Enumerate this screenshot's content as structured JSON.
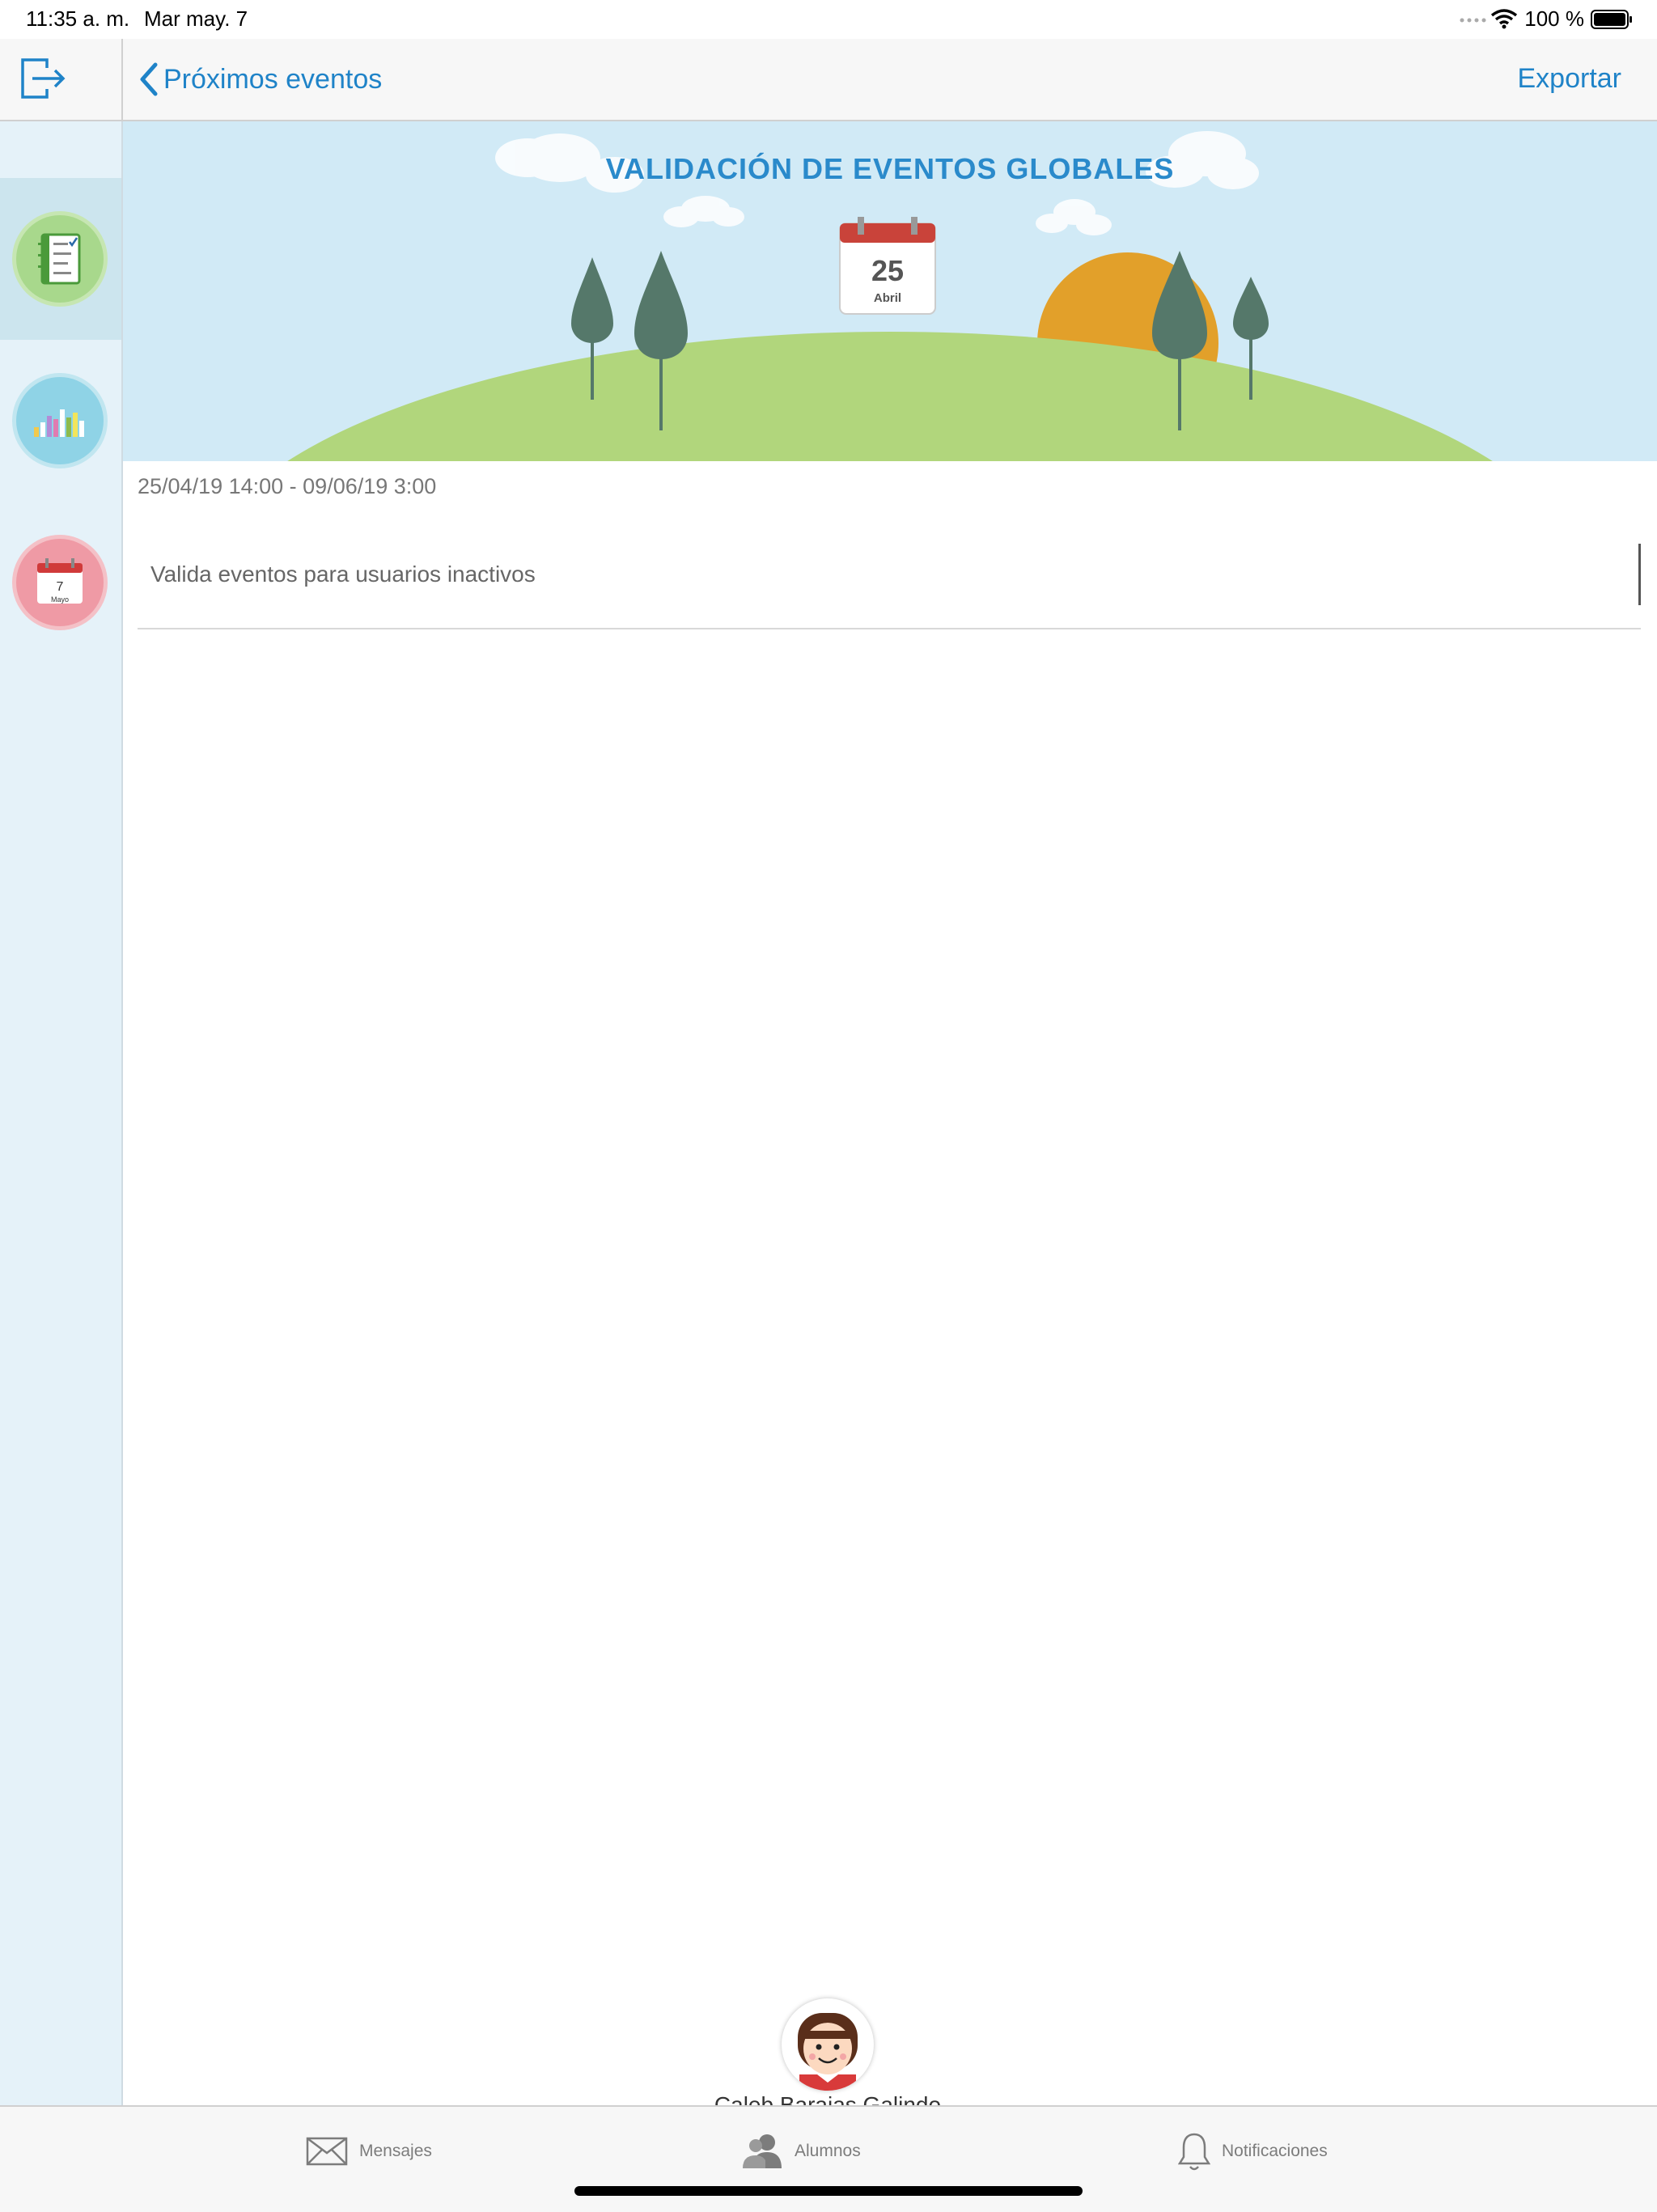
{
  "status_bar": {
    "time": "11:35 a. m.",
    "date": "Mar may. 7",
    "battery_percent": "100 %"
  },
  "nav": {
    "back_label": "Próximos eventos",
    "export_label": "Exportar"
  },
  "sidebar": {
    "items": [
      {
        "name": "tasks",
        "icon": "checklist-icon",
        "color": "#a8d88c",
        "active": true
      },
      {
        "name": "stats",
        "icon": "bar-chart-icon",
        "color": "#8fd3e6",
        "active": false
      },
      {
        "name": "calendar",
        "icon": "calendar-icon",
        "color": "#ef9aa5",
        "day": "7",
        "month": "Mayo",
        "active": false
      }
    ]
  },
  "banner": {
    "title": "VALIDACIÓN DE EVENTOS GLOBALES",
    "calendar_day": "25",
    "calendar_month": "Abril"
  },
  "event": {
    "date_range": "25/04/19 14:00 - 09/06/19 3:00",
    "description": "Valida eventos para usuarios inactivos"
  },
  "user": {
    "name": "Caleb Barajas Galindo"
  },
  "tabs": [
    {
      "label": "Mensajes",
      "icon": "envelope-icon"
    },
    {
      "label": "Alumnos",
      "icon": "users-icon"
    },
    {
      "label": "Notificaciones",
      "icon": "bell-icon"
    }
  ],
  "colors": {
    "accent": "#1f83c8",
    "sky": "#d1eaf6",
    "hill": "#b1d67c",
    "sun": "#e2a02a",
    "tree": "#55786a"
  }
}
